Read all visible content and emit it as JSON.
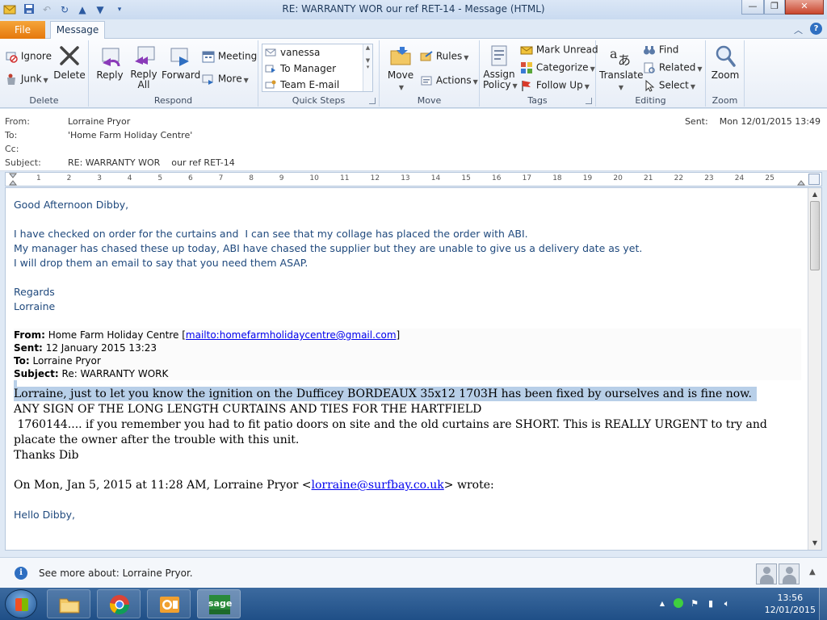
{
  "window": {
    "title": "RE: WARRANTY WOR    our ref RET-14  -  Message (HTML)",
    "minimize": "—",
    "maximize": "❐",
    "close": "✕"
  },
  "quick_access": [
    "save-icon",
    "undo-icon",
    "redo-icon",
    "up-icon",
    "down-icon",
    "customize-icon"
  ],
  "tabs": {
    "file": "File",
    "message": "Message"
  },
  "ribbon": {
    "delete_group": {
      "label": "Delete",
      "ignore": "Ignore",
      "junk": "Junk",
      "delete": "Delete"
    },
    "respond_group": {
      "label": "Respond",
      "reply": "Reply",
      "reply_all_1": "Reply",
      "reply_all_2": "All",
      "forward": "Forward",
      "meeting": "Meeting",
      "more": "More"
    },
    "quick_steps": {
      "label": "Quick Steps",
      "items": [
        "vanessa",
        "To Manager",
        "Team E-mail"
      ]
    },
    "move_group": {
      "label": "Move",
      "move": "Move",
      "rules": "Rules",
      "actions": "Actions"
    },
    "tags_group": {
      "label": "Tags",
      "assign_policy_1": "Assign",
      "assign_policy_2": "Policy",
      "mark_unread": "Mark Unread",
      "categorize": "Categorize",
      "follow_up": "Follow Up"
    },
    "editing_group": {
      "label": "Editing",
      "translate": "Translate",
      "find": "Find",
      "related": "Related",
      "select": "Select"
    },
    "zoom_group": {
      "label": "Zoom",
      "zoom": "Zoom"
    }
  },
  "header": {
    "from_label": "From:",
    "from": "Lorraine Pryor",
    "to_label": "To:",
    "to": "'Home Farm Holiday Centre'",
    "cc_label": "Cc:",
    "cc": "",
    "subject_label": "Subject:",
    "subject": "RE: WARRANTY WOR    our ref RET-14",
    "sent_label": "Sent:",
    "sent": "Mon 12/01/2015 13:49"
  },
  "ruler": {
    "ticks": [
      "1",
      "2",
      "3",
      "4",
      "5",
      "6",
      "7",
      "8",
      "9",
      "10",
      "11",
      "12",
      "13",
      "14",
      "15",
      "16",
      "17",
      "18",
      "19",
      "20",
      "21",
      "22",
      "23",
      "24",
      "25"
    ]
  },
  "body": {
    "greeting": "Good Afternoon Dibby,",
    "para1": "I have checked on order for the curtains and  I can see that my collage has placed the order with ABI.",
    "para2": "My manager has chased these up today, ABI have chased the supplier but they are unable to give us a delivery date as yet.",
    "para3": "I will drop them an email to say that you need them ASAP.",
    "regards": "Regards",
    "signature": "Lorraine",
    "quoted": {
      "from_label": "From:",
      "from": "Home Farm Holiday Centre [",
      "mailto": "mailto:homefarmholidaycentre@gmail.com",
      "from_end": "]",
      "sent_label": "Sent:",
      "sent": "12 January 2015 13:23",
      "to_label": "To:",
      "to": "Lorraine Pryor",
      "subject_label": "Subject:",
      "subject": "Re: WARRANTY WORK"
    },
    "selected_line": "Lorraine, just to let you know the ignition on the Dufficey BORDEAUX 35x12 1703H has been fixed by ourselves and is fine now.",
    "caps_line": "ANY SIGN OF THE LONG LENGTH CURTAINS AND TIES FOR THE HARTFIELD",
    "urgent_line": " 1760144.... if you remember you had to fit patio doors on site and the old curtains are SHORT. This is REALLY URGENT to try and placate the owner after the trouble with this unit.",
    "thanks": "Thanks Dib",
    "on_prefix": "On Mon, Jan 5, 2015 at 11:28 AM, Lorraine Pryor <",
    "on_email": "lorraine@surfbay.co.uk",
    "on_suffix": "> wrote:",
    "hello": "Hello Dibby,"
  },
  "people_pane": {
    "text": "See more about: Lorraine Pryor."
  },
  "taskbar": {
    "apps": [
      "explorer-icon",
      "chrome-icon",
      "outlook-icon",
      "sage-icon"
    ],
    "sage_label": "sage",
    "time": "13:56",
    "date": "12/01/2015"
  },
  "colors": {
    "accent": "#e5780c",
    "body_text": "#1f497d",
    "selection": "#b8cfe8",
    "link": "#0000ee"
  }
}
